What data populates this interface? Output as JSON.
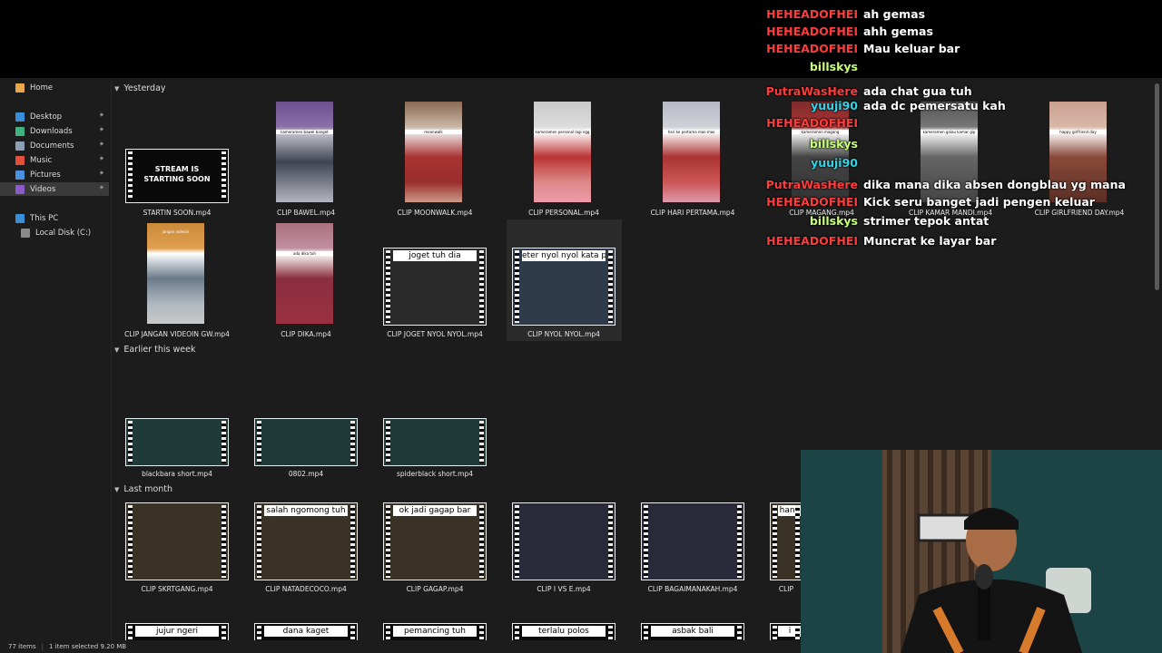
{
  "statusbar": {
    "items": "77 items",
    "selected": "1 item selected  9.20 MB"
  },
  "sidebar": {
    "home": "Home",
    "quick": [
      {
        "label": "Desktop",
        "icon": "desktop-icon",
        "color": "#3b8fd9"
      },
      {
        "label": "Downloads",
        "icon": "download-icon",
        "color": "#3fb27f"
      },
      {
        "label": "Documents",
        "icon": "document-icon",
        "color": "#8e9fb5"
      },
      {
        "label": "Music",
        "icon": "music-icon",
        "color": "#e2503a"
      },
      {
        "label": "Pictures",
        "icon": "picture-icon",
        "color": "#4a8fe0"
      },
      {
        "label": "Videos",
        "icon": "video-icon",
        "color": "#8b5cc7"
      }
    ],
    "this_pc": "This PC",
    "local_disk": "Local Disk (C:)"
  },
  "groups": {
    "yesterday": "Yesterday",
    "earlier": "Earlier this week",
    "last_month": "Last month"
  },
  "files": {
    "row1": [
      "STARTIN SOON.mp4",
      "CLIP BAWEL.mp4",
      "CLIP MOONWALK.mp4",
      "CLIP PERSONAL.mp4",
      "CLIP HARI PERTAMA.mp4",
      "CLIP MAGANG.mp4",
      "CLIP KAMAR MANDI.mp4",
      "CLIP GIRLFRIEND DAY.mp4"
    ],
    "row2": [
      "CLIP JANGAN VIDEOIN GW.mp4",
      "CLIP DIKA.mp4",
      "CLIP JOGET NYOL NYOL.mp4",
      "CLIP NYOL NYOL.mp4"
    ],
    "row2_captions": [
      "",
      "",
      "joget tuh dia",
      "eter nyol nyol kata pun"
    ],
    "row3": [
      "blackbara short.mp4",
      "0802.mp4",
      "spiderblack short.mp4"
    ],
    "row4": [
      "CLIP SKRTGANG.mp4",
      "CLIP NATADECOCO.mp4",
      "CLIP GAGAP.mp4",
      "CLIP I VS E.mp4",
      "CLIP BAGAIMANAKAH.mp4",
      "CLIP"
    ],
    "row4_captions": [
      "",
      "salah ngomong tuh",
      "ok jadi gagap bar",
      "",
      "",
      "hang"
    ],
    "row5_captions": [
      "jujur ngeri",
      "dana kaget",
      "pemancing tuh",
      "terlalu polos",
      "asbak bali",
      "i"
    ],
    "thumb_texts": {
      "startin": "STREAM IS STARTING SOON",
      "bawel": "kameramen bawel banget",
      "moonwalk": "moonwalk",
      "personal": "kameramen personal lagi ngg",
      "hari": "hari ke pertama mas-mas",
      "magang": "kameramen magang",
      "kamar": "kameramen galau kamar gip",
      "girlfriend": "happy girlfriend day",
      "jangan": "jangan videoin",
      "dika": "ada dika tuh"
    }
  },
  "chat": [
    {
      "user": "HEHEADOFHEI",
      "color": "#ff3b3b",
      "text": "ah gemas"
    },
    {
      "user": "HEHEADOFHEI",
      "color": "#ff3b3b",
      "text": "ahh gemas"
    },
    {
      "user": "HEHEADOFHEI",
      "color": "#ff3b3b",
      "text": "Mau keluar bar"
    },
    {
      "user": "billskys",
      "color": "#c8ff7a",
      "text": ""
    },
    {
      "user": "PutraWasHere",
      "color": "#ff3b3b",
      "text": "ada chat gua tuh"
    },
    {
      "user": "yuuji90",
      "color": "#30d5e8",
      "text": "ada dc pemersatu kah"
    },
    {
      "user": "HEHEADOFHEI",
      "color": "#ff3b3b",
      "text": ""
    },
    {
      "user": "billskys",
      "color": "#c8ff7a",
      "text": ""
    },
    {
      "user": "yuuji90",
      "color": "#30d5e8",
      "text": ""
    },
    {
      "user": "PutraWasHere",
      "color": "#ff3b3b",
      "text": "dika mana dika absen dongblau yg mana"
    },
    {
      "user": "HEHEADOFHEI",
      "color": "#ff3b3b",
      "text": "Kick seru banget jadi pengen keluar"
    },
    {
      "user": "billskys",
      "color": "#c8ff7a",
      "text": "strimer tepok antat"
    },
    {
      "user": "HEHEADOFHEI",
      "color": "#ff3b3b",
      "text": "Muncrat ke layar bar"
    }
  ]
}
